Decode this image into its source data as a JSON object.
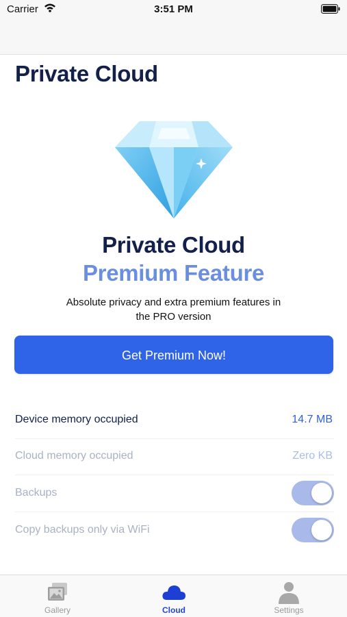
{
  "status_bar": {
    "carrier": "Carrier",
    "time": "3:51 PM"
  },
  "header": {
    "title": "Private Cloud"
  },
  "promo": {
    "icon": "diamond-icon",
    "title": "Private Cloud",
    "subtitle": "Premium Feature",
    "description": "Absolute privacy and extra premium features in the PRO version",
    "cta_label": "Get Premium Now!"
  },
  "settings": {
    "rows": [
      {
        "label": "Device memory occupied",
        "value": "14.7 MB",
        "enabled": true
      },
      {
        "label": "Cloud memory occupied",
        "value": "Zero KB",
        "enabled": false
      },
      {
        "label": "Backups",
        "toggle_on": true,
        "enabled": false
      },
      {
        "label": "Copy backups only via WiFi",
        "toggle_on": true,
        "enabled": false
      }
    ]
  },
  "tab_bar": {
    "tabs": [
      {
        "label": "Gallery",
        "icon": "gallery-icon",
        "selected": false
      },
      {
        "label": "Cloud",
        "icon": "cloud-icon",
        "selected": true
      },
      {
        "label": "Settings",
        "icon": "person-icon",
        "selected": false
      }
    ]
  },
  "colors": {
    "accent": "#2f63e8",
    "title": "#12204a",
    "subtitle": "#6b8fe0",
    "toggle_disabled": "#a9b9ea",
    "tab_active": "#2145d6"
  }
}
